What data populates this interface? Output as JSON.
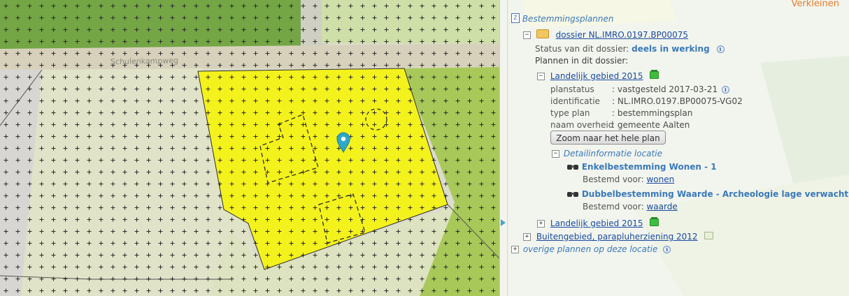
{
  "map": {
    "road_label": "Schulenkampweg",
    "marker": "location-pin"
  },
  "panel": {
    "close_label": "Verkleinen",
    "root_label": "Bestemmingsplannen",
    "dossier": {
      "label": "dossier NL.IMRO.0197.BP00075",
      "status_label": "Status van dit dossier:",
      "status_value": "deels in werking",
      "plans_label": "Plannen in dit dossier:"
    },
    "plan1": {
      "title": "Landelijk gebied 2015",
      "attrs": [
        {
          "key": "planstatus",
          "value": ": vastgesteld 2017-03-21"
        },
        {
          "key": "identificatie",
          "value": ": NL.IMRO.0197.BP00075-VG02"
        },
        {
          "key": "type plan",
          "value": ": bestemmingsplan"
        },
        {
          "key": "naam overheid",
          "value": ": gemeente Aalten"
        }
      ],
      "zoom_button": "Zoom naar het hele plan",
      "detail_label": "Detailinformatie locatie",
      "details": [
        {
          "title": "Enkelbestemming Wonen - 1",
          "sub_label": "Bestemd voor:",
          "sub_value": "wonen"
        },
        {
          "title": "Dubbelbestemming Waarde - Archeologie lage verwachting",
          "sub_label": "Bestemd voor:",
          "sub_value": "waarde"
        }
      ]
    },
    "plan2": {
      "title": "Landelijk gebied 2015"
    },
    "plan3": {
      "title": "Buitengebied, parapluherziening 2012"
    },
    "other_plans": "overige plannen op deze locatie"
  }
}
